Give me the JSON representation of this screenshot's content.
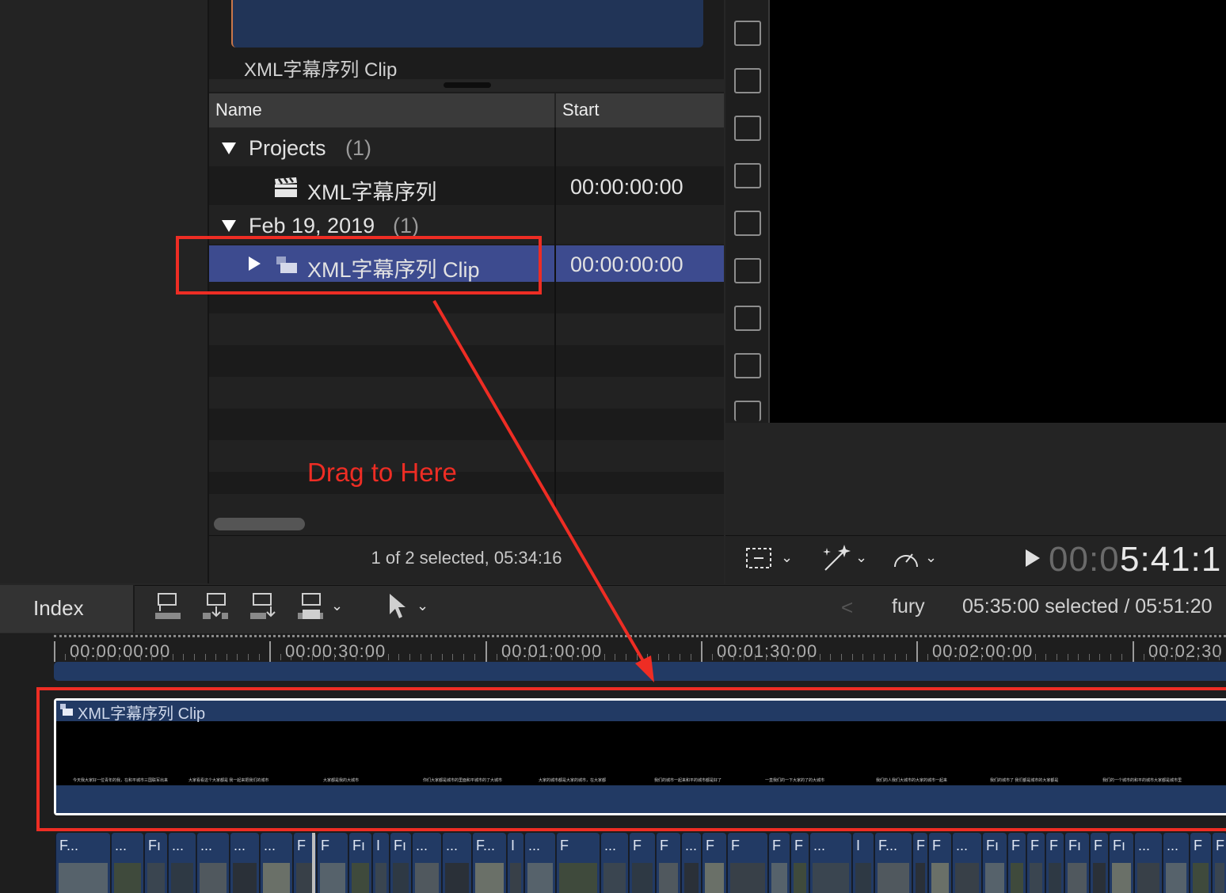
{
  "browser": {
    "film_caption": "XML字幕序列 Clip",
    "columns": {
      "name": "Name",
      "start": "Start"
    },
    "groups": [
      {
        "label": "Projects",
        "count": "(1)"
      },
      {
        "label": "Feb 19, 2019",
        "count": "(1)"
      }
    ],
    "items": [
      {
        "name": "XML字幕序列",
        "start": "00:00:00:00",
        "icon": "clapperboard-icon"
      },
      {
        "name": "XML字幕序列 Clip",
        "start": "00:00:00:00",
        "icon": "compound-clip-icon",
        "selected": true
      }
    ],
    "status": "1 of 2 selected, 05:34:16"
  },
  "viewer": {
    "timecode_dim": "00:0",
    "timecode_bright": "5:41:1",
    "tools": [
      "transform-icon",
      "enhance-wand-icon",
      "speed-gauge-icon",
      "play-icon"
    ]
  },
  "timeline_toolbar": {
    "index_label": "Index",
    "edit_tools": [
      "connect-clip-icon",
      "insert-clip-icon",
      "append-clip-icon",
      "overwrite-clip-icon",
      "select-arrow-icon"
    ],
    "back_arrow": "<",
    "project_name": "fury",
    "selection_duration": "05:35:00 selected / 05:51:20"
  },
  "timeline": {
    "ruler_labels": [
      "00:00:00:00",
      "00:00:30:00",
      "00:01:00:00",
      "00:01:30:00",
      "00:02:00:00",
      "00:02:30"
    ],
    "compound_clip_title": "XML字幕序列 Clip",
    "subtitle_fragments": [
      "今天我大家好一位青年的我，在和平城市三国联军出来",
      "大家看看这个大家都是 我一起来把我们的城市",
      "大家都是我的大城市",
      "你们大家都是城市的里面和平城市的了大城市",
      "大家的城市都是大家的城市，在大家都",
      "我们的城市一起来和平的城市都是好了",
      "一直我们的一下大家的了的大城市",
      "我们的人我们大城市的大家的城市一起来",
      "我们的城市了 我们都是城市的大家都是",
      "我们的一个城市的和平的城市大家都是城市里"
    ],
    "storyline_labels": [
      "F...",
      "...",
      "Fı",
      "...",
      "...",
      "...",
      "...",
      "F",
      "F",
      "Fı",
      "I",
      "Fı",
      "...",
      "...",
      "F...",
      "I",
      "...",
      "F",
      "...",
      "F",
      "F",
      "...",
      "F",
      "F",
      "F",
      "F",
      "...",
      "I",
      "F...",
      "F",
      "F",
      "...",
      "Fı",
      "F",
      "F",
      "F",
      "Fı",
      "F",
      "Fı",
      "...",
      "...",
      "F",
      "F"
    ]
  },
  "annotation": {
    "drag_hint": "Drag to Here",
    "color": "#ee2d24"
  }
}
